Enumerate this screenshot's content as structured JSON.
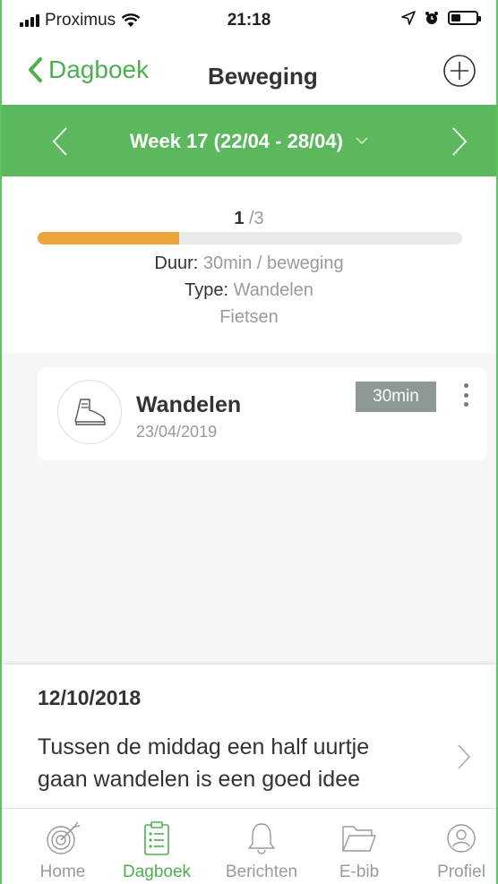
{
  "status_bar": {
    "carrier": "Proximus",
    "time": "21:18"
  },
  "nav": {
    "back_label": "Dagboek",
    "title": "Beweging"
  },
  "week": {
    "label": "Week 17 (22/04 - 28/04)"
  },
  "summary": {
    "done": "1",
    "total": "/3",
    "progress_fraction": 0.333,
    "duration_label": "Duur:",
    "duration_value": "30min / beweging",
    "type_label": "Type:",
    "types": [
      "Wandelen",
      "Fietsen"
    ]
  },
  "entries": [
    {
      "title": "Wandelen",
      "date": "23/04/2019",
      "duration": "30min",
      "icon": "hiking-boot-icon"
    }
  ],
  "tip": {
    "date": "12/10/2018",
    "text": "Tussen de middag een half uurtje gaan wandelen is een goed idee"
  },
  "tabs": [
    {
      "label": "Home",
      "icon": "target-icon",
      "active": false
    },
    {
      "label": "Dagboek",
      "icon": "clipboard-icon",
      "active": true
    },
    {
      "label": "Berichten",
      "icon": "bell-icon",
      "active": false
    },
    {
      "label": "E-bib",
      "icon": "folder-icon",
      "active": false
    },
    {
      "label": "Profiel",
      "icon": "user-icon",
      "active": false
    }
  ],
  "colors": {
    "brand_green": "#5cb85c",
    "progress_orange": "#e9a43a",
    "badge_gray": "#8e9894"
  }
}
